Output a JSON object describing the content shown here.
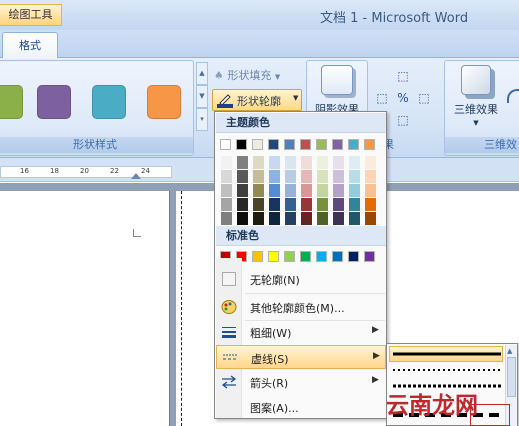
{
  "title_bar": {
    "context_tools": "绘图工具",
    "window_title": "文档 1 - Microsoft Word"
  },
  "tabs": [
    {
      "label": "格式",
      "active": true
    }
  ],
  "ribbon": {
    "shape_style_swatches": [
      "#8bb04a",
      "#7d60a0",
      "#4bacc6",
      "#f79646"
    ],
    "shape_fill": "形状填充",
    "shape_outline": "形状轮廓",
    "shadow_effect": "阴影效果",
    "three_d_effect": "三维效果",
    "groups": {
      "shape_styles": "形状样式",
      "shadow_partial": "果",
      "three_d": "三维效"
    }
  },
  "ruler": {
    "ticks": [
      "16",
      "18",
      "20",
      "22",
      "24"
    ]
  },
  "outline_menu": {
    "theme_colors_header": "主题颜色",
    "theme_colors": [
      "#ffffff",
      "#000000",
      "#eeece1",
      "#1f497d",
      "#4f81bd",
      "#c0504d",
      "#9bbb59",
      "#8064a2",
      "#4bacc6",
      "#f79646"
    ],
    "theme_shades": [
      [
        "#f2f2f2",
        "#d8d8d8",
        "#bfbfbf",
        "#a5a5a5",
        "#7f7f7f"
      ],
      [
        "#7f7f7f",
        "#595959",
        "#3f3f3f",
        "#262626",
        "#0c0c0c"
      ],
      [
        "#ddd9c3",
        "#c4bd97",
        "#938953",
        "#494429",
        "#1d1b10"
      ],
      [
        "#c6d9f0",
        "#8db3e2",
        "#548dd4",
        "#17365d",
        "#0f243e"
      ],
      [
        "#dbe5f1",
        "#b8cce4",
        "#95b3d7",
        "#366092",
        "#244061"
      ],
      [
        "#f2dcdb",
        "#e5b9b7",
        "#d99694",
        "#953734",
        "#632423"
      ],
      [
        "#ebf1dd",
        "#d7e3bc",
        "#c3d69b",
        "#76923c",
        "#4f6128"
      ],
      [
        "#e5e0ec",
        "#ccc1d9",
        "#b2a2c7",
        "#5f497a",
        "#3f3151"
      ],
      [
        "#dbeef3",
        "#b7dde8",
        "#92cddc",
        "#31859b",
        "#205867"
      ],
      [
        "#fdeada",
        "#fbd5b5",
        "#fac08f",
        "#e36c09",
        "#974806"
      ]
    ],
    "standard_colors_header": "标准色",
    "standard_colors": [
      "#c00000",
      "#ff0000",
      "#ffc000",
      "#ffff00",
      "#92d050",
      "#00b050",
      "#00b0f0",
      "#0070c0",
      "#002060",
      "#7030a0"
    ],
    "no_outline": "无轮廓(N)",
    "more_colors": "其他轮廓颜色(M)...",
    "weight": "粗细(W)",
    "dashes": "虚线(S)",
    "arrows": "箭头(R)",
    "pattern": "图案(A)..."
  },
  "watermark": "云南龙网"
}
